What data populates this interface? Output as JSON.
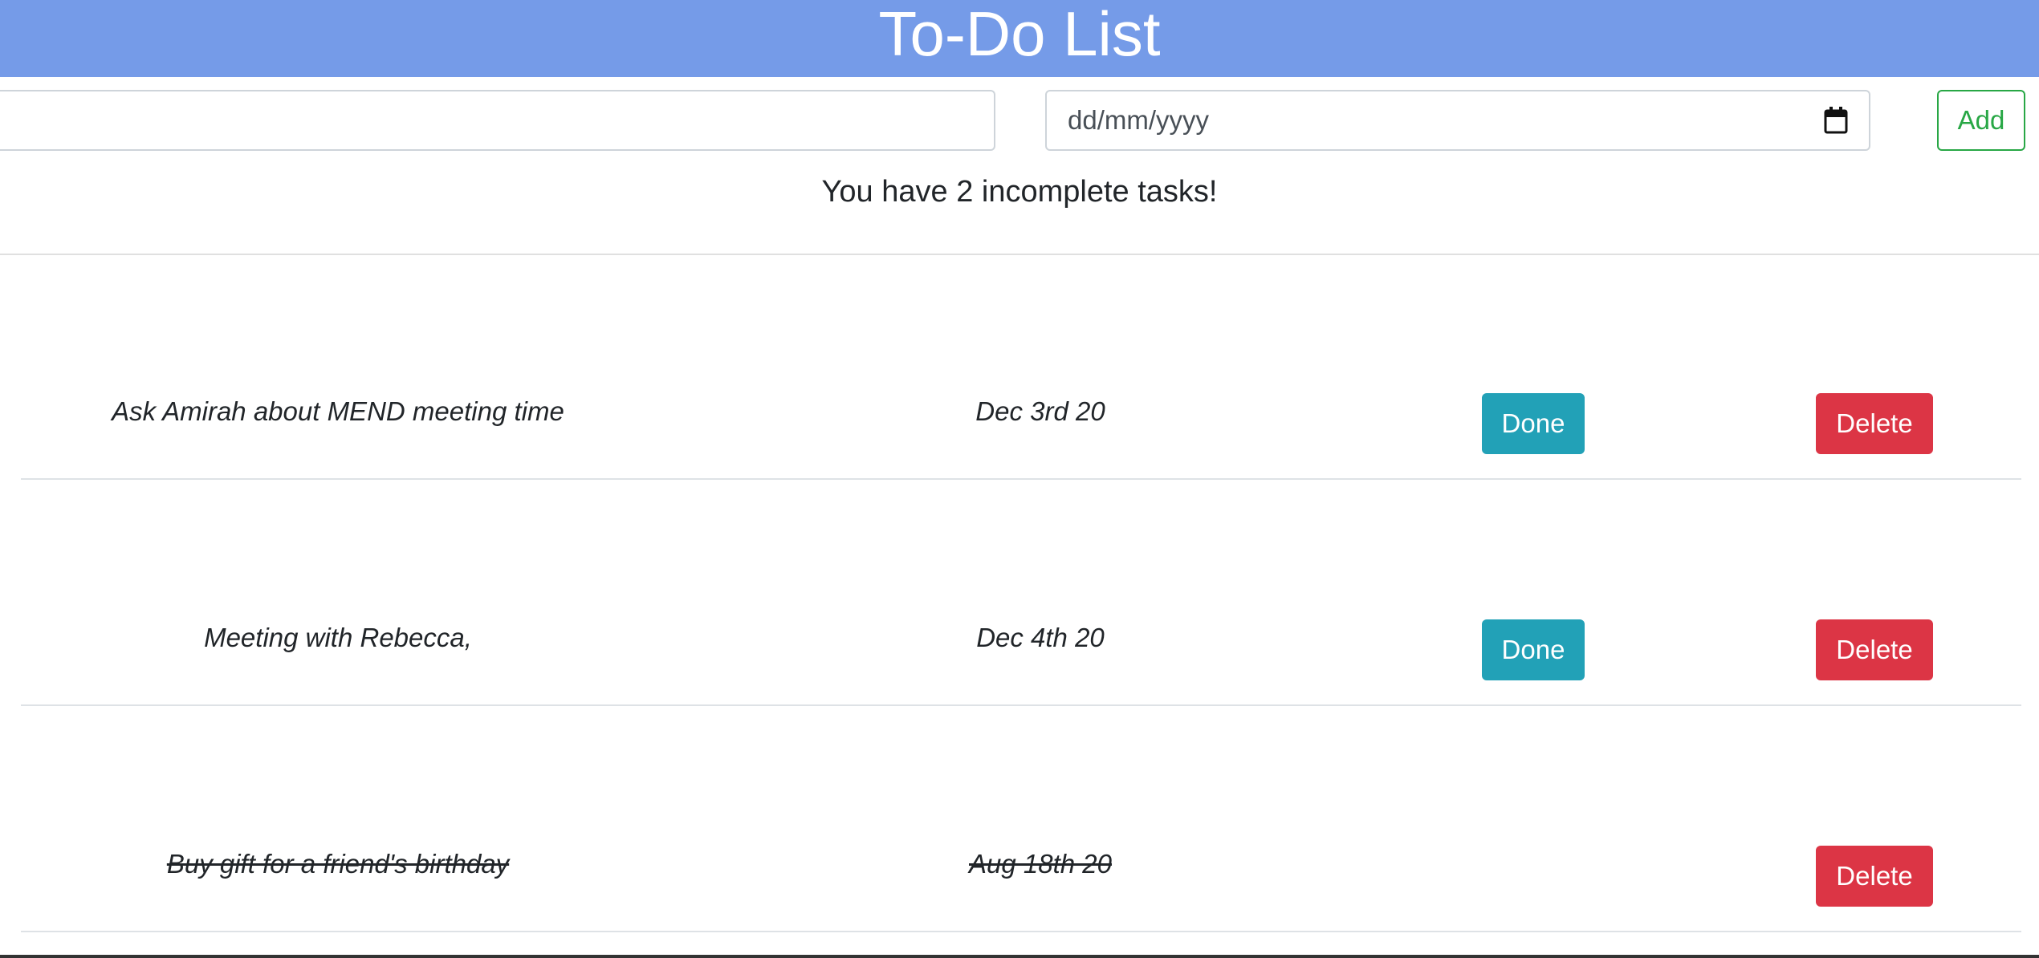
{
  "header": {
    "title": "To-Do List"
  },
  "form": {
    "task_placeholder": "",
    "date_placeholder": "dd/mm/yyyy",
    "add_label": "Add"
  },
  "status": {
    "text": "You have 2 incomplete tasks!"
  },
  "tasks": [
    {
      "name": "Ask Amirah about MEND meeting time",
      "date": "Dec 3rd 20",
      "completed": false,
      "done_label": "Done",
      "delete_label": "Delete"
    },
    {
      "name": "Meeting with Rebecca,",
      "date": "Dec 4th 20",
      "completed": false,
      "done_label": "Done",
      "delete_label": "Delete"
    },
    {
      "name": "Buy gift for a friend's birthday",
      "date": "Aug 18th 20",
      "completed": true,
      "delete_label": "Delete"
    }
  ],
  "colors": {
    "header": "#759be8",
    "done_button": "#22a1b7",
    "delete_button": "#dc3545",
    "add_button": "#28a745"
  },
  "icons": {
    "date_picker": "calendar-icon"
  }
}
